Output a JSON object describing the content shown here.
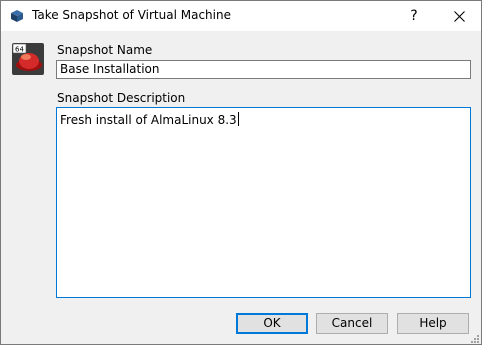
{
  "window": {
    "title": "Take Snapshot of Virtual Machine",
    "help_glyph": "?",
    "icons": {
      "app": "virtualbox-cube-icon",
      "close": "close-icon",
      "vm": "vm-os-icon",
      "grip": "resize-grip-icon"
    },
    "vm_icon_badge": "64"
  },
  "form": {
    "name_label": "Snapshot Name",
    "name_value": "Base Installation",
    "description_label": "Snapshot Description",
    "description_value": "Fresh install of AlmaLinux 8.3"
  },
  "buttons": {
    "ok": "OK",
    "cancel": "Cancel",
    "help": "Help"
  },
  "colors": {
    "focus_accent": "#0078d7",
    "dialog_bg": "#f0f0f0",
    "button_bg": "#e1e1e1"
  }
}
